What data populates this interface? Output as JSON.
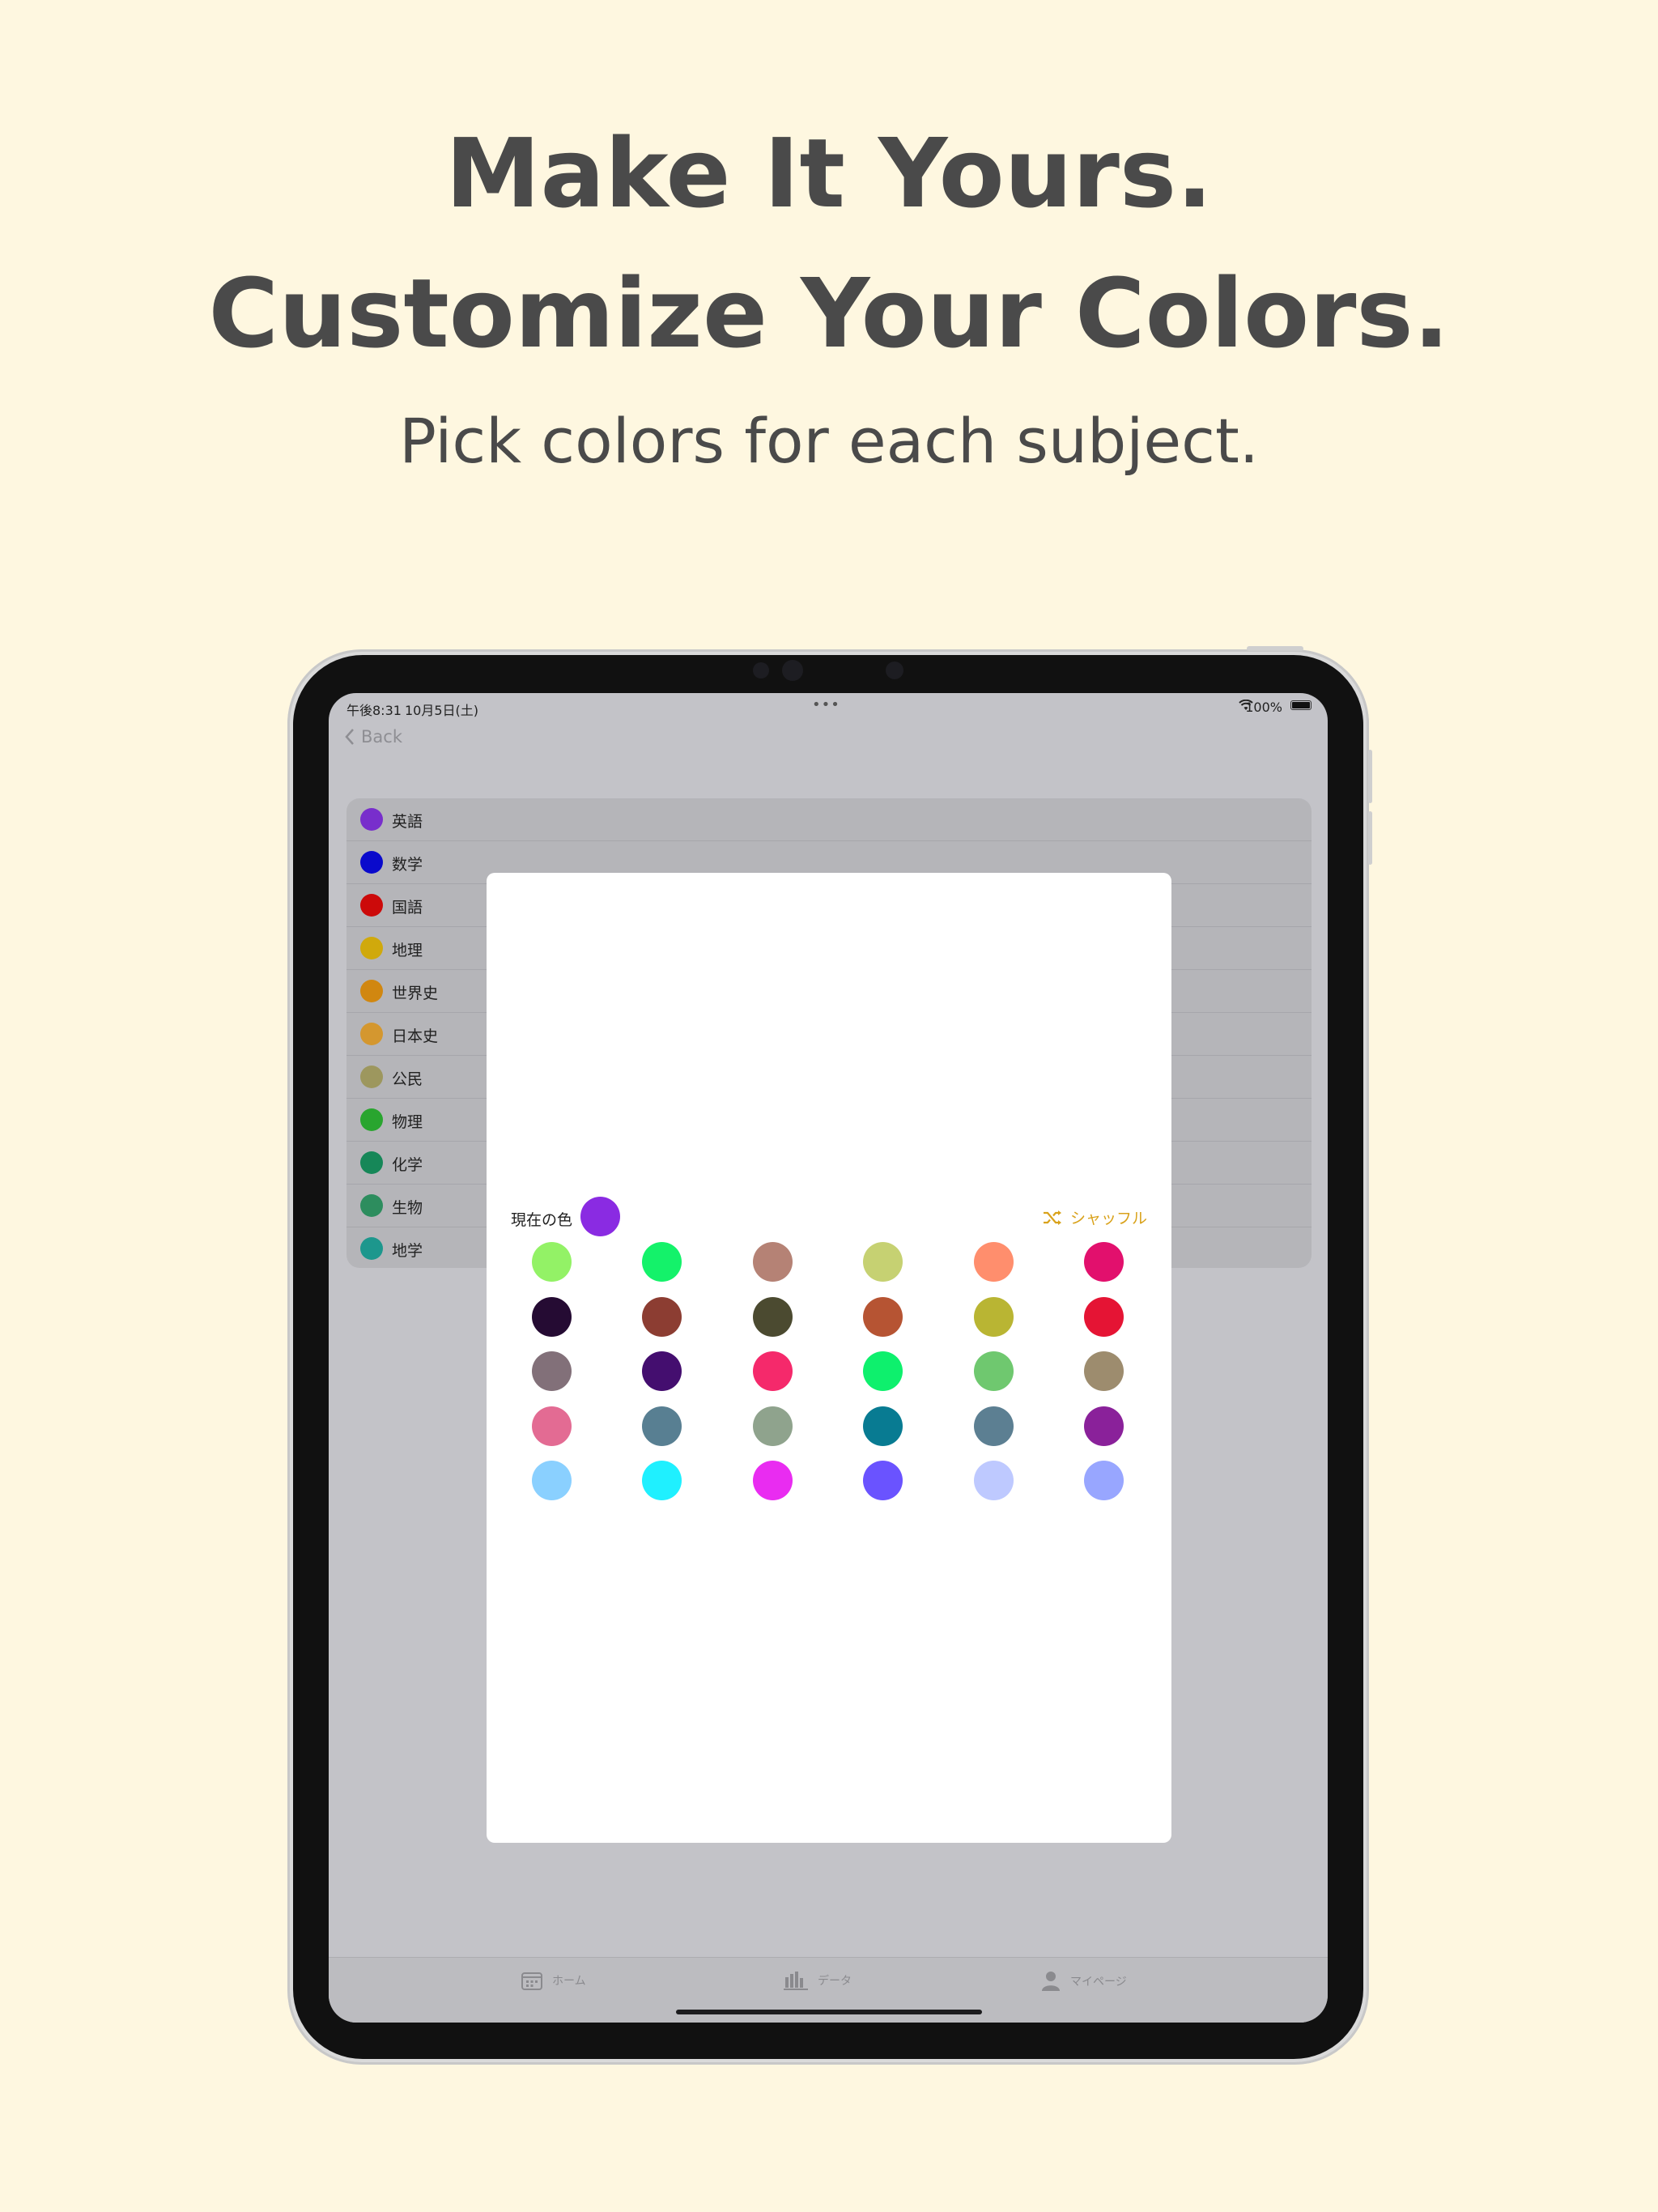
{
  "promo": {
    "headline_line1": "Make It Yours.",
    "headline_line2": "Customize Your Colors.",
    "subtitle": "Pick colors for each subject."
  },
  "status_bar": {
    "time": "午後8:31",
    "date": "10月5日(土)",
    "battery": "100%"
  },
  "nav": {
    "back_label": "Back"
  },
  "subjects": [
    {
      "label": "英語",
      "color": "#7a2fd0"
    },
    {
      "label": "数学",
      "color": "#0a0ad0"
    },
    {
      "label": "国語",
      "color": "#d00a0a"
    },
    {
      "label": "地理",
      "color": "#d4ac0c"
    },
    {
      "label": "世界史",
      "color": "#d58a10"
    },
    {
      "label": "日本史",
      "color": "#d89a30"
    },
    {
      "label": "公民",
      "color": "#a09a60"
    },
    {
      "label": "物理",
      "color": "#2aa830"
    },
    {
      "label": "化学",
      "color": "#168a5a"
    },
    {
      "label": "生物",
      "color": "#2e9060"
    },
    {
      "label": "地学",
      "color": "#1e9a90"
    }
  ],
  "color_picker": {
    "current_label": "現在の色",
    "current_color": "#8a2be2",
    "shuffle_label": "シャッフル",
    "accent_color": "#d9a21b",
    "palette": [
      [
        "#93f266",
        "#14f26a",
        "#b58275",
        "#c6d172",
        "#ff8e6d",
        "#e2106d"
      ],
      [
        "#250b33",
        "#8c3d32",
        "#4b4a30",
        "#b65433",
        "#b9b533",
        "#e51434"
      ],
      [
        "#827079",
        "#440e6f",
        "#f5296b",
        "#0ef06d",
        "#6fc86f",
        "#9d8c6e"
      ],
      [
        "#e36b93",
        "#587f92",
        "#8fa38d",
        "#087b92",
        "#5c7f92",
        "#8a219a"
      ],
      [
        "#8ad0ff",
        "#1ff0ff",
        "#e92cf1",
        "#6a53ff",
        "#bec9ff",
        "#98a6ff"
      ]
    ]
  },
  "tab_bar": [
    {
      "label": "ホーム",
      "icon": "calendar-icon"
    },
    {
      "label": "データ",
      "icon": "chart-icon"
    },
    {
      "label": "マイページ",
      "icon": "person-icon"
    }
  ],
  "background_color": "#fef7e0"
}
